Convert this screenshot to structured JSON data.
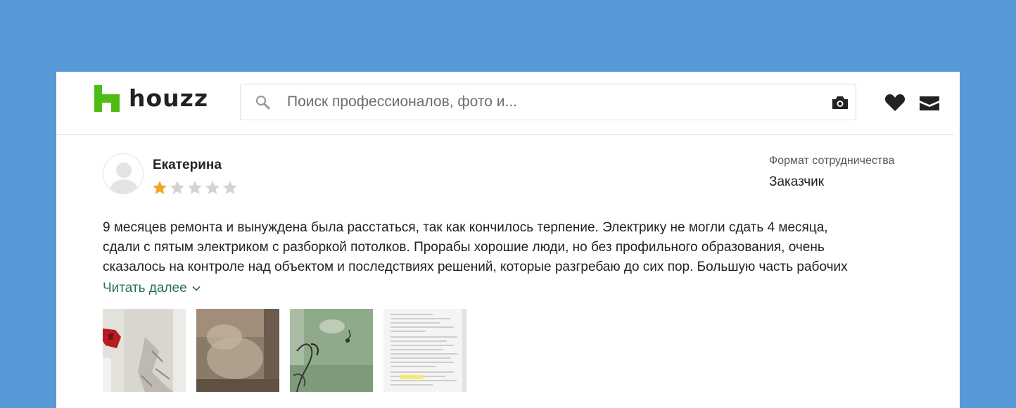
{
  "app": {
    "logo_text": "houzz",
    "brand_color": "#4dbc15"
  },
  "search": {
    "placeholder": "Поиск профессионалов, фото и..."
  },
  "header": {
    "icons": [
      "search-icon",
      "camera-icon",
      "heart-icon",
      "mail-icon"
    ]
  },
  "review": {
    "author": "Екатерина",
    "rating": 1,
    "rating_max": 5,
    "star_color_filled": "#f5a623",
    "star_color_empty": "#d3d3d3",
    "collaboration_label": "Формат сотрудничества",
    "collaboration_value": "Заказчик",
    "text_lines": [
      "9 месяцев ремонта и вынуждена была расстаться, так как кончилось терпение. Электрику не могли сдать 4 месяца,",
      "сдали с пятым электриком с разборкой потолков. Прорабы хорошие люди, но без профильного образования, очень",
      "сказалось на контроле над объектом и последствиях решений, которые разгребаю до сих пор. Большую часть рабочих"
    ],
    "read_more": "Читать далее",
    "read_more_color": "#2a6f57",
    "photos": [
      {
        "name": "photo-damaged-wall"
      },
      {
        "name": "photo-dusty-floor"
      },
      {
        "name": "photo-green-wall-wires"
      },
      {
        "name": "photo-document"
      }
    ]
  }
}
